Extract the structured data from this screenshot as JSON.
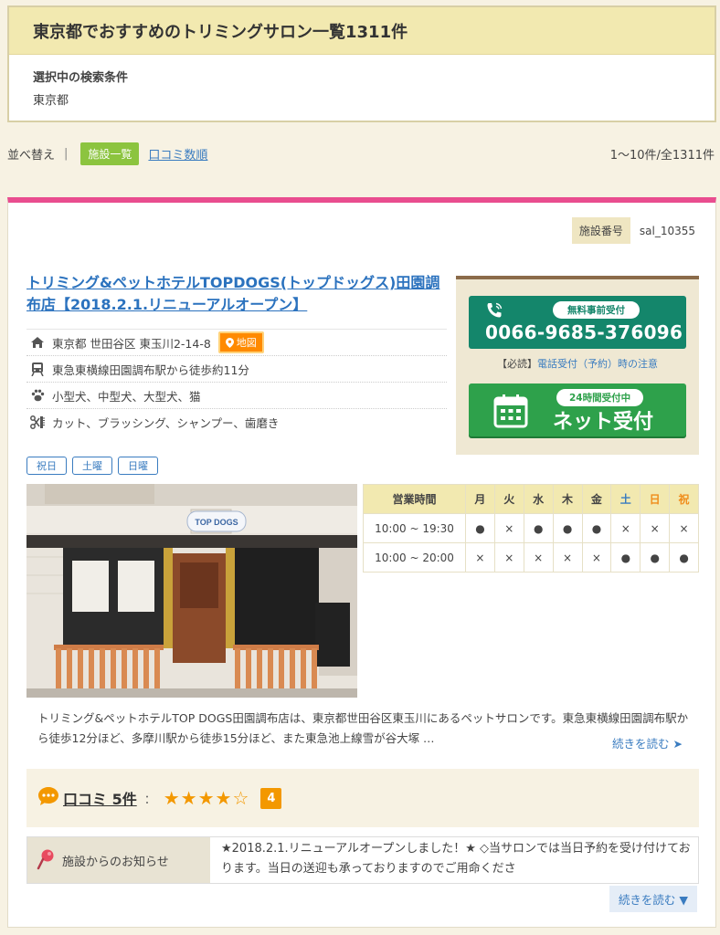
{
  "header": {
    "title": "東京都でおすすめのトリミングサロン一覧1311件",
    "criteria_label": "選択中の検索条件",
    "criteria_value": "東京都"
  },
  "sortbar": {
    "label": "並べ替え",
    "separator": "|",
    "active": "施設一覧",
    "link": "口コミ数順",
    "count": "1〜10件/全1311件"
  },
  "listing": {
    "facility_no_label": "施設番号",
    "facility_no": "sal_10355",
    "title": "トリミング&ペットホテルTOPDOGS(トップドッグス)田園調布店【2018.2.1.リニューアルオープン】",
    "address": "東京都 世田谷区 東玉川2-14-8",
    "map_label": "地図",
    "access": "東急東横線田園調布駅から徒歩約11分",
    "pets": "小型犬、中型犬、大型犬、猫",
    "services": "カット、ブラッシング、シャンプー、歯磨き",
    "tags": [
      "祝日",
      "土曜",
      "日曜"
    ],
    "phone_badge": "無料事前受付",
    "phone": "0066-9685-376096",
    "phone_note_prefix": "【必読】",
    "phone_note_link": "電話受付（予約）時の注意",
    "net_badge": "24時間受付中",
    "net_label": "ネット受付",
    "photo_sign": "TOP DOGS",
    "hours": {
      "header": [
        "営業時間",
        "月",
        "火",
        "水",
        "木",
        "金",
        "土",
        "日",
        "祝"
      ],
      "rows": [
        {
          "time": "10:00 ~ 19:30",
          "marks": [
            "●",
            "×",
            "●",
            "●",
            "●",
            "×",
            "×",
            "×"
          ]
        },
        {
          "time": "10:00 ~ 20:00",
          "marks": [
            "×",
            "×",
            "×",
            "×",
            "×",
            "●",
            "●",
            "●"
          ]
        }
      ]
    },
    "description": "トリミング&ペットホテルTOP DOGS田園調布店は、東京都世田谷区東玉川にあるペットサロンです。東急東横線田園調布駅から徒歩12分ほど、多摩川駅から徒歩15分ほど、また東急池上線雪が谷大塚 …",
    "read_more": "続きを読む ➤",
    "review_label": "口コミ 5件",
    "review_colon": "：",
    "stars_filled": "★★★★",
    "stars_empty": "☆",
    "score": "4",
    "notice_label": "施設からのお知らせ",
    "notice_text": "★2018.2.1.リニューアルオープンしました！★ ◇当サロンでは当日予約を受け付けております。当日の送迎も承っておりますのでご用命くださ",
    "notice_more": "続きを読む ▼"
  },
  "colors": {
    "accent_pink": "#e94d8f",
    "green": "#8cc43f",
    "phone_green": "#14866b",
    "net_green": "#2ea14b",
    "orange": "#f39800",
    "link_blue": "#3a7cc0"
  }
}
